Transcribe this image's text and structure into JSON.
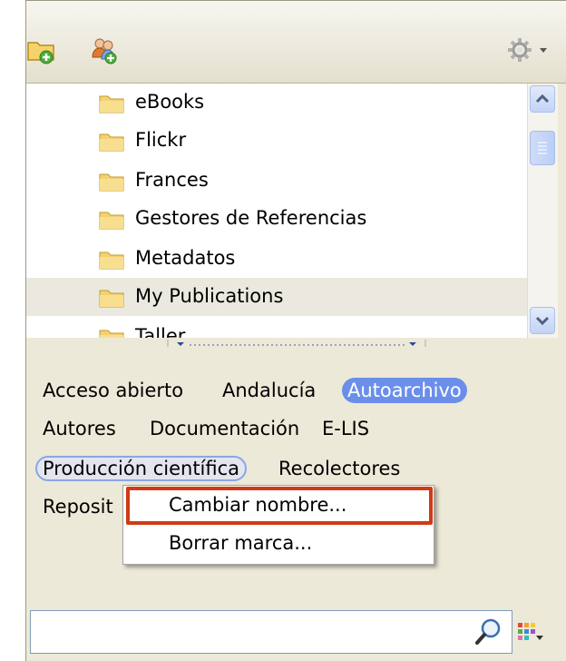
{
  "toolbar": {
    "new_collection_icon": "folder-add-icon",
    "new_group_icon": "group-add-icon",
    "actions_icon": "gear-icon"
  },
  "tree": {
    "items": [
      {
        "label": "eBooks"
      },
      {
        "label": "Flickr"
      },
      {
        "label": "Frances"
      },
      {
        "label": "Gestores de Referencias"
      },
      {
        "label": "Metadatos"
      },
      {
        "label": "My Publications"
      },
      {
        "label": "Taller"
      }
    ]
  },
  "tags": {
    "items": [
      {
        "label": "Acceso abierto"
      },
      {
        "label": "Andalucía"
      },
      {
        "label": "Autoarchivo"
      },
      {
        "label": "Autores"
      },
      {
        "label": "Documentación"
      },
      {
        "label": "E-LIS"
      },
      {
        "label": "Producción científica"
      },
      {
        "label": "Recolectores"
      },
      {
        "label": "Reposit"
      }
    ]
  },
  "context_menu": {
    "rename": "Cambiar nombre...",
    "delete": "Borrar marca..."
  },
  "search": {
    "value": "",
    "placeholder": ""
  },
  "colors": {
    "active_tag": "#6b8fe9",
    "highlight_border": "#d03a16"
  }
}
